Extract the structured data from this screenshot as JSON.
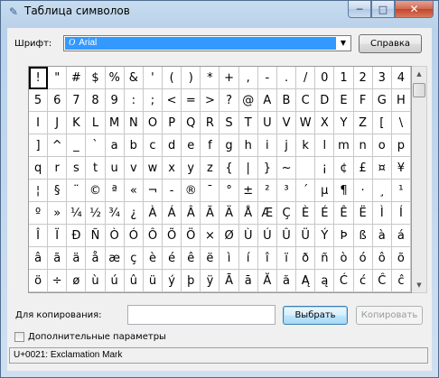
{
  "window": {
    "title": "Таблица символов",
    "caption_min": "─",
    "caption_max": "□",
    "caption_close": "✕"
  },
  "font": {
    "label": "Шрифт:",
    "value": "Arial",
    "help_button": "Справка"
  },
  "grid": {
    "selected_index": 0,
    "chars": [
      "!",
      "\"",
      "#",
      "$",
      "%",
      "&",
      "'",
      "(",
      ")",
      "*",
      "+",
      ",",
      "-",
      ".",
      "/",
      "0",
      "1",
      "2",
      "3",
      "4",
      "5",
      "6",
      "7",
      "8",
      "9",
      ":",
      ";",
      "<",
      "=",
      ">",
      "?",
      "@",
      "A",
      "B",
      "C",
      "D",
      "E",
      "F",
      "G",
      "H",
      "I",
      "J",
      "K",
      "L",
      "M",
      "N",
      "O",
      "P",
      "Q",
      "R",
      "S",
      "T",
      "U",
      "V",
      "W",
      "X",
      "Y",
      "Z",
      "[",
      "\\",
      "]",
      "^",
      "_",
      "`",
      "a",
      "b",
      "c",
      "d",
      "e",
      "f",
      "g",
      "h",
      "i",
      "j",
      "k",
      "l",
      "m",
      "n",
      "o",
      "p",
      "q",
      "r",
      "s",
      "t",
      "u",
      "v",
      "w",
      "x",
      "y",
      "z",
      "{",
      "|",
      "}",
      "~",
      "",
      "¡",
      "¢",
      "£",
      "¤",
      "¥",
      "¦",
      "§",
      "¨",
      "©",
      "ª",
      "«",
      "¬",
      "-",
      "®",
      "¯",
      "°",
      "±",
      "²",
      "³",
      "´",
      "µ",
      "¶",
      "·",
      "¸",
      "¹",
      "º",
      "»",
      "¼",
      "½",
      "¾",
      "¿",
      "À",
      "Á",
      "Â",
      "Ã",
      "Ä",
      "Å",
      "Æ",
      "Ç",
      "È",
      "É",
      "Ê",
      "Ë",
      "Ì",
      "Í",
      "Î",
      "Ï",
      "Ð",
      "Ñ",
      "Ò",
      "Ó",
      "Ô",
      "Õ",
      "Ö",
      "×",
      "Ø",
      "Ù",
      "Ú",
      "Û",
      "Ü",
      "Ý",
      "Þ",
      "ß",
      "à",
      "á",
      "â",
      "ã",
      "ä",
      "å",
      "æ",
      "ç",
      "è",
      "é",
      "ê",
      "ë",
      "ì",
      "í",
      "î",
      "ï",
      "ð",
      "ñ",
      "ò",
      "ó",
      "ô",
      "õ",
      "ö",
      "÷",
      "ø",
      "ù",
      "ú",
      "û",
      "ü",
      "ý",
      "þ",
      "ÿ",
      "Ā",
      "ā",
      "Ă",
      "ă",
      "Ą",
      "ą",
      "Ć",
      "ć",
      "Ĉ",
      "ĉ"
    ]
  },
  "copy": {
    "label": "Для копирования:",
    "value": "",
    "select_button": "Выбрать",
    "copy_button": "Копировать"
  },
  "advanced": {
    "label": "Дополнительные параметры",
    "checked": false
  },
  "status": {
    "text": "U+0021: Exclamation Mark"
  }
}
